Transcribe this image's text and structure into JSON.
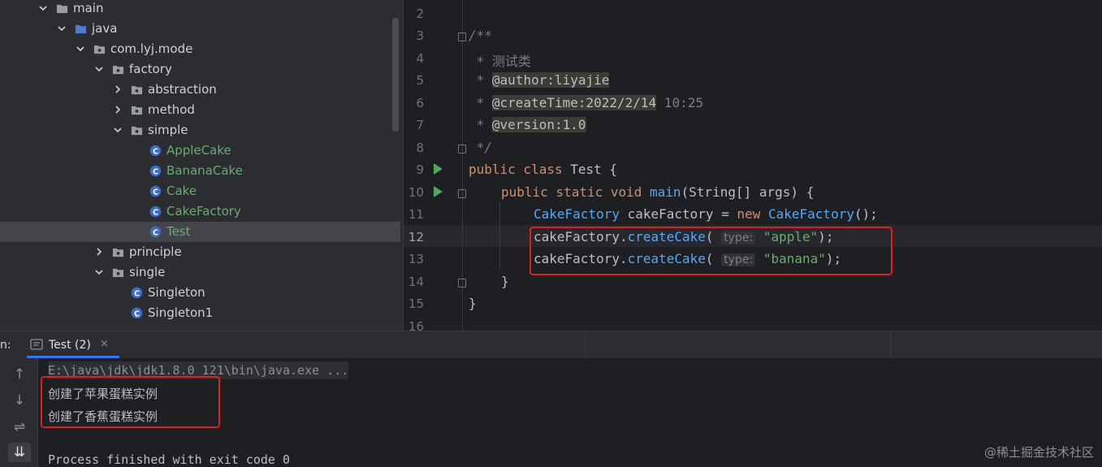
{
  "project_tree": {
    "items": [
      {
        "label": "main",
        "depth": 0,
        "expanded": true,
        "icon": "folder-icon"
      },
      {
        "label": "java",
        "depth": 1,
        "expanded": true,
        "icon": "source-folder-icon"
      },
      {
        "label": "com.lyj.mode",
        "depth": 2,
        "expanded": true,
        "icon": "package-icon"
      },
      {
        "label": "factory",
        "depth": 3,
        "expanded": true,
        "icon": "package-icon"
      },
      {
        "label": "abstraction",
        "depth": 4,
        "expanded": false,
        "icon": "package-icon"
      },
      {
        "label": "method",
        "depth": 4,
        "expanded": false,
        "icon": "package-icon"
      },
      {
        "label": "simple",
        "depth": 4,
        "expanded": true,
        "icon": "package-icon"
      },
      {
        "label": "AppleCake",
        "depth": 5,
        "icon": "class-icon",
        "modified": true
      },
      {
        "label": "BananaCake",
        "depth": 5,
        "icon": "class-icon",
        "modified": true
      },
      {
        "label": "Cake",
        "depth": 5,
        "icon": "class-icon",
        "modified": true
      },
      {
        "label": "CakeFactory",
        "depth": 5,
        "icon": "class-icon",
        "modified": true
      },
      {
        "label": "Test",
        "depth": 5,
        "icon": "class-icon",
        "modified": true,
        "selected": true
      },
      {
        "label": "principle",
        "depth": 3,
        "expanded": false,
        "icon": "package-icon"
      },
      {
        "label": "single",
        "depth": 3,
        "expanded": true,
        "icon": "package-icon"
      },
      {
        "label": "Singleton",
        "depth": 4,
        "icon": "class-icon"
      },
      {
        "label": "Singleton1",
        "depth": 4,
        "icon": "class-icon"
      }
    ]
  },
  "editor": {
    "line_numbers": [
      "2",
      "3",
      "4",
      "5",
      "6",
      "7",
      "8",
      "9",
      "10",
      "11",
      "12",
      "13",
      "14",
      "15",
      "16"
    ],
    "current_line": "12",
    "code": {
      "l3": "/**",
      "l4_star": " * ",
      "l4_text": "测试类",
      "l5_star": " * ",
      "l5_tag": "@author:liyajie",
      "l6_star": " * ",
      "l6_tag": "@createTime:2022/2/14",
      "l6_rest": " 10:25",
      "l7_star": " * ",
      "l7_tag": "@version:1.0",
      "l8": " */",
      "l9_kw": "public class ",
      "l9_name": "Test",
      "l9_rest": " {",
      "l10_kw": "public static void ",
      "l10_fn": "main",
      "l10_rest": "(String[] args) {",
      "l11_type": "CakeFactory",
      "l11_mid": " cakeFactory = ",
      "l11_kw": "new ",
      "l11_type2": "CakeFactory",
      "l11_end": "();",
      "l12_obj": "cakeFactory.",
      "l12_method": "createCake",
      "l12_open": "( ",
      "l12_hint": "type:",
      "l12_str": "\"apple\"",
      "l12_end": ");",
      "l13_obj": "cakeFactory.",
      "l13_method": "createCake",
      "l13_open": "( ",
      "l13_hint": "type:",
      "l13_str": "\"banana\"",
      "l13_end": ");",
      "l14": "}",
      "l15": "}"
    }
  },
  "run_panel": {
    "label": "n:",
    "tab_label": "Test (2)",
    "tab_close": "×",
    "console": {
      "command": "E:\\java\\jdk\\jdk1.8.0_121\\bin\\java.exe ...",
      "output": [
        "创建了苹果蛋糕实例",
        "创建了香蕉蛋糕实例"
      ],
      "exit": "Process finished with exit code 0"
    },
    "side_buttons": [
      "↑",
      "↓",
      "⇌",
      "⇊"
    ]
  },
  "watermark": "@稀土掘金技术社区",
  "colors": {
    "accent": "#3574f0",
    "highlight_box": "#e0201c",
    "run_green": "#4ca85f"
  }
}
